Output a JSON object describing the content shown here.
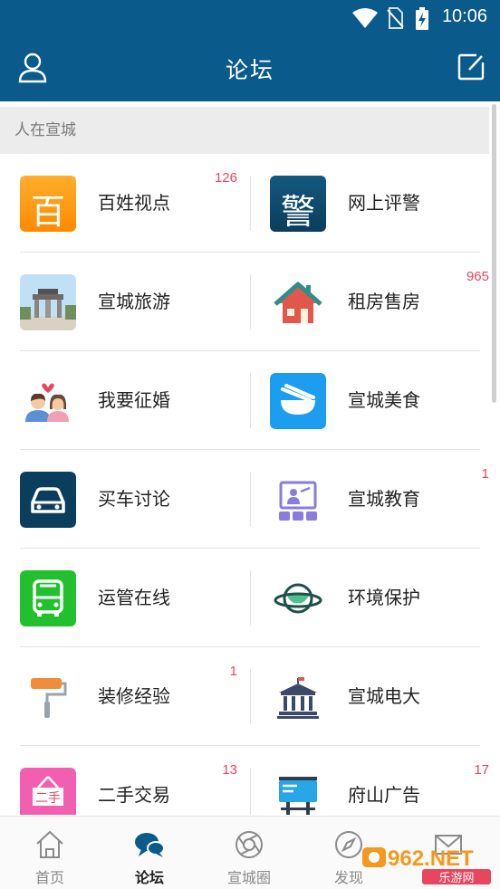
{
  "status_bar": {
    "time": "10:06"
  },
  "header": {
    "title": "论坛"
  },
  "section": {
    "title": "人在宣城"
  },
  "items": [
    {
      "left": {
        "label": "百姓视点",
        "badge": "126",
        "icon": "bai-char-icon",
        "icon_char": "百"
      },
      "right": {
        "label": "网上评警",
        "badge": "",
        "icon": "jing-char-icon",
        "icon_char": "警"
      }
    },
    {
      "left": {
        "label": "宣城旅游",
        "badge": "",
        "icon": "memorial-arch-photo-icon"
      },
      "right": {
        "label": "租房售房",
        "badge": "965",
        "icon": "house-icon"
      }
    },
    {
      "left": {
        "label": "我要征婚",
        "badge": "",
        "icon": "couple-icon"
      },
      "right": {
        "label": "宣城美食",
        "badge": "",
        "icon": "food-bowl-icon"
      }
    },
    {
      "left": {
        "label": "买车讨论",
        "badge": "",
        "icon": "car-icon"
      },
      "right": {
        "label": "宣城教育",
        "badge": "1",
        "icon": "classroom-icon"
      }
    },
    {
      "left": {
        "label": "运管在线",
        "badge": "",
        "icon": "bus-icon"
      },
      "right": {
        "label": "环境保护",
        "badge": "",
        "icon": "planet-icon"
      }
    },
    {
      "left": {
        "label": "装修经验",
        "badge": "1",
        "icon": "paint-roller-icon"
      },
      "right": {
        "label": "宣城电大",
        "badge": "",
        "icon": "university-building-icon"
      }
    },
    {
      "left": {
        "label": "二手交易",
        "badge": "13",
        "icon": "secondhand-sign-icon",
        "icon_text": "二手"
      },
      "right": {
        "label": "府山广告",
        "badge": "17",
        "icon": "billboard-icon"
      }
    }
  ],
  "tabs": [
    {
      "label": "首页",
      "icon": "home-icon"
    },
    {
      "label": "论坛",
      "icon": "chat-bubbles-icon",
      "active": true
    },
    {
      "label": "宣城圈",
      "icon": "aperture-icon"
    },
    {
      "label": "发现",
      "icon": "compass-icon"
    },
    {
      "label": "",
      "icon": "mail-icon"
    }
  ],
  "watermark": {
    "text": "962.NET",
    "subtext": "乐游网"
  },
  "colors": {
    "brand": "#0a5a8c",
    "badge": "#e8455e",
    "section_bg": "#ececec"
  }
}
